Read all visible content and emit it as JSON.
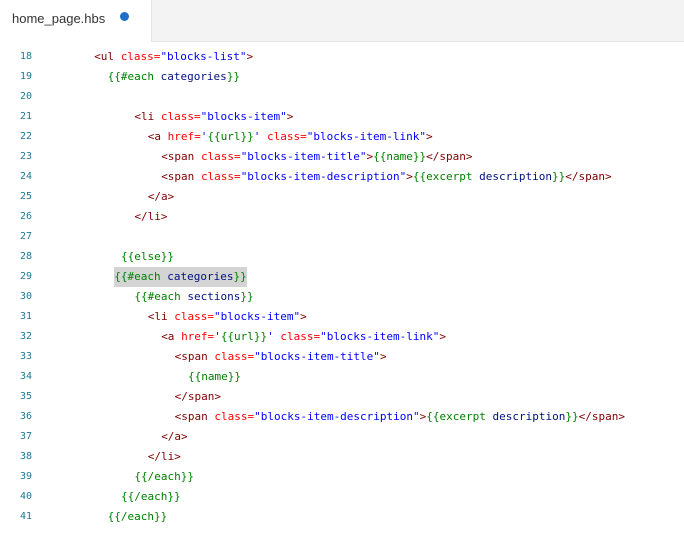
{
  "tab": {
    "title": "home_page.hbs"
  },
  "lines": [
    {
      "num": "18",
      "indent": 3,
      "tokens": [
        [
          "tag",
          "<ul "
        ],
        [
          "attr",
          "class="
        ],
        [
          "str",
          "\"blocks-list\""
        ],
        [
          "tag",
          ">"
        ]
      ]
    },
    {
      "num": "19",
      "indent": 4,
      "tokens": [
        [
          "hb",
          "{{#each "
        ],
        [
          "hbtxt",
          "categories"
        ],
        [
          "hb",
          "}}"
        ]
      ]
    },
    {
      "num": "20",
      "indent": 0,
      "tokens": []
    },
    {
      "num": "21",
      "indent": 6,
      "tokens": [
        [
          "tag",
          "<li "
        ],
        [
          "attr",
          "class="
        ],
        [
          "str",
          "\"blocks-item\""
        ],
        [
          "tag",
          ">"
        ]
      ]
    },
    {
      "num": "22",
      "indent": 7,
      "tokens": [
        [
          "tag",
          "<a "
        ],
        [
          "attr",
          "href="
        ],
        [
          "str",
          "'"
        ],
        [
          "hb",
          "{{url}}"
        ],
        [
          "str",
          "' "
        ],
        [
          "attr",
          "class="
        ],
        [
          "str",
          "\"blocks-item-link\""
        ],
        [
          "tag",
          ">"
        ]
      ]
    },
    {
      "num": "23",
      "indent": 8,
      "tokens": [
        [
          "tag",
          "<span "
        ],
        [
          "attr",
          "class="
        ],
        [
          "str",
          "\"blocks-item-title\""
        ],
        [
          "tag",
          ">"
        ],
        [
          "hb",
          "{{name}}"
        ],
        [
          "tag",
          "</span>"
        ]
      ]
    },
    {
      "num": "24",
      "indent": 8,
      "tokens": [
        [
          "tag",
          "<span "
        ],
        [
          "attr",
          "class="
        ],
        [
          "str",
          "\"blocks-item-description\""
        ],
        [
          "tag",
          ">"
        ],
        [
          "hb",
          "{{excerpt "
        ],
        [
          "hbtxt",
          "description"
        ],
        [
          "hb",
          "}}"
        ],
        [
          "tag",
          "</span>"
        ]
      ]
    },
    {
      "num": "25",
      "indent": 7,
      "tokens": [
        [
          "tag",
          "</a>"
        ]
      ]
    },
    {
      "num": "26",
      "indent": 6,
      "tokens": [
        [
          "tag",
          "</li>"
        ]
      ]
    },
    {
      "num": "27",
      "indent": 0,
      "tokens": []
    },
    {
      "num": "28",
      "indent": 5,
      "tokens": [
        [
          "hb",
          "{{else}}"
        ]
      ]
    },
    {
      "num": "29",
      "indent": 4.5,
      "highlight": true,
      "tokens": [
        [
          "hb",
          "{{#each "
        ],
        [
          "hbtxt",
          "categories"
        ],
        [
          "hb",
          "}}"
        ]
      ]
    },
    {
      "num": "30",
      "indent": 6,
      "tokens": [
        [
          "hb",
          "{{#each "
        ],
        [
          "hbtxt",
          "sections"
        ],
        [
          "hb",
          "}}"
        ]
      ]
    },
    {
      "num": "31",
      "indent": 7,
      "tokens": [
        [
          "tag",
          "<li "
        ],
        [
          "attr",
          "class="
        ],
        [
          "str",
          "\"blocks-item\""
        ],
        [
          "tag",
          ">"
        ]
      ]
    },
    {
      "num": "32",
      "indent": 8,
      "tokens": [
        [
          "tag",
          "<a "
        ],
        [
          "attr",
          "href="
        ],
        [
          "str",
          "'"
        ],
        [
          "hb",
          "{{url}}"
        ],
        [
          "str",
          "' "
        ],
        [
          "attr",
          "class="
        ],
        [
          "str",
          "\"blocks-item-link\""
        ],
        [
          "tag",
          ">"
        ]
      ]
    },
    {
      "num": "33",
      "indent": 9,
      "tokens": [
        [
          "tag",
          "<span "
        ],
        [
          "attr",
          "class="
        ],
        [
          "str",
          "\"blocks-item-title\""
        ],
        [
          "tag",
          ">"
        ]
      ]
    },
    {
      "num": "34",
      "indent": 10,
      "tokens": [
        [
          "hb",
          "{{name}}"
        ]
      ]
    },
    {
      "num": "35",
      "indent": 9,
      "tokens": [
        [
          "tag",
          "</span>"
        ]
      ]
    },
    {
      "num": "36",
      "indent": 9,
      "tokens": [
        [
          "tag",
          "<span "
        ],
        [
          "attr",
          "class="
        ],
        [
          "str",
          "\"blocks-item-description\""
        ],
        [
          "tag",
          ">"
        ],
        [
          "hb",
          "{{excerpt "
        ],
        [
          "hbtxt",
          "description"
        ],
        [
          "hb",
          "}}"
        ],
        [
          "tag",
          "</span>"
        ]
      ]
    },
    {
      "num": "37",
      "indent": 8,
      "tokens": [
        [
          "tag",
          "</a>"
        ]
      ]
    },
    {
      "num": "38",
      "indent": 7,
      "tokens": [
        [
          "tag",
          "</li>"
        ]
      ]
    },
    {
      "num": "39",
      "indent": 6,
      "tokens": [
        [
          "hb",
          "{{/each}}"
        ]
      ]
    },
    {
      "num": "40",
      "indent": 5,
      "tokens": [
        [
          "hb",
          "{{/each}}"
        ]
      ]
    },
    {
      "num": "41",
      "indent": 4,
      "tokens": [
        [
          "hb",
          "{{/each}}"
        ]
      ]
    }
  ]
}
